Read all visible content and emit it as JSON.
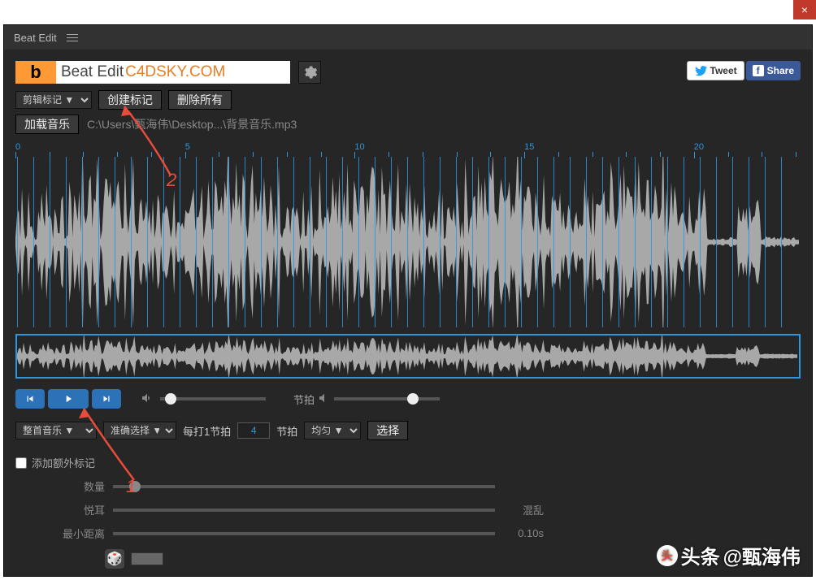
{
  "window": {
    "close": "×"
  },
  "panel": {
    "title": "Beat Edit"
  },
  "logo": {
    "b": "b",
    "name": "Beat Edit",
    "url": "C4DSKY.COM"
  },
  "share": {
    "tweet": "Tweet",
    "fb": "Share"
  },
  "toolbar": {
    "marker_select": "剪辑标记 ▼",
    "create_marker": "创建标记",
    "delete_all": "删除所有",
    "load_music": "加载音乐",
    "file_path": "C:\\Users\\甄海伟\\Desktop...\\背景音乐.mp3"
  },
  "ruler": {
    "t0": "0",
    "t5": "5",
    "t10": "10",
    "t15": "15",
    "t20": "20"
  },
  "transport": {
    "volume_label": "",
    "tempo_label": "节拍"
  },
  "params": {
    "scope_select": "整首音乐    ▼",
    "accuracy_select": "准确选择   ▼",
    "every_beat_label": "每打1节拍",
    "every_beat_value": "4",
    "tempo_label": "节拍",
    "uniform_select": "均匀 ▼",
    "select_btn": "选择"
  },
  "extra": {
    "add_extra_label": "添加额外标记",
    "qty_label": "数量",
    "pleasant_label": "悦耳",
    "chaos_label": "混乱",
    "min_dist_label": "最小距离",
    "min_dist_value": "0.10s"
  },
  "annotations": {
    "n1": "1",
    "n2": "2"
  },
  "watermark": {
    "brand": "头条",
    "author": "@甄海伟"
  }
}
